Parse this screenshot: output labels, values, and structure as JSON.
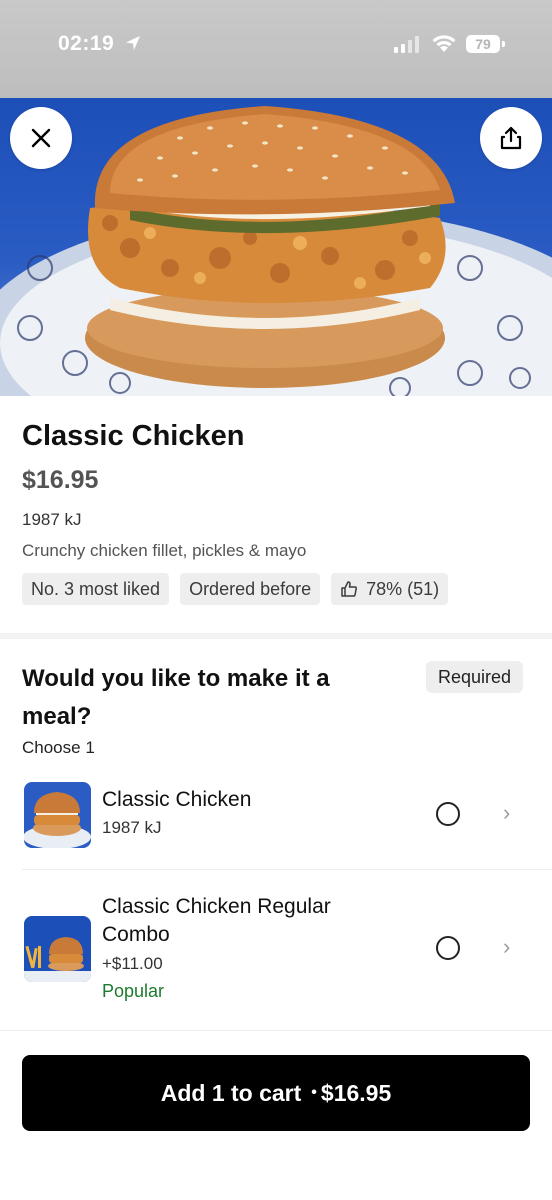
{
  "status_bar": {
    "time": "02:19",
    "battery": "79"
  },
  "product": {
    "name": "Classic Chicken",
    "price": "$16.95",
    "energy": "1987 kJ",
    "description": "Crunchy chicken fillet, pickles & mayo",
    "badges": [
      "No. 3 most liked",
      "Ordered before",
      "78% (51)"
    ]
  },
  "meal_section": {
    "question": "Would you like to make it a meal?",
    "required_label": "Required",
    "choose_label": "Choose 1",
    "options": [
      {
        "name": "Classic Chicken",
        "sub": "1987 kJ",
        "selected": false
      },
      {
        "name": "Classic Chicken Regular Combo",
        "sub": "+$11.00",
        "tag": "Popular",
        "selected": false
      }
    ]
  },
  "cart_button": {
    "label": "Add 1 to cart",
    "separator": "•",
    "total": "$16.95"
  },
  "colors": {
    "accent_green": "#1d7a2f",
    "button_bg": "#000000",
    "chip_bg": "#eeeeee"
  }
}
